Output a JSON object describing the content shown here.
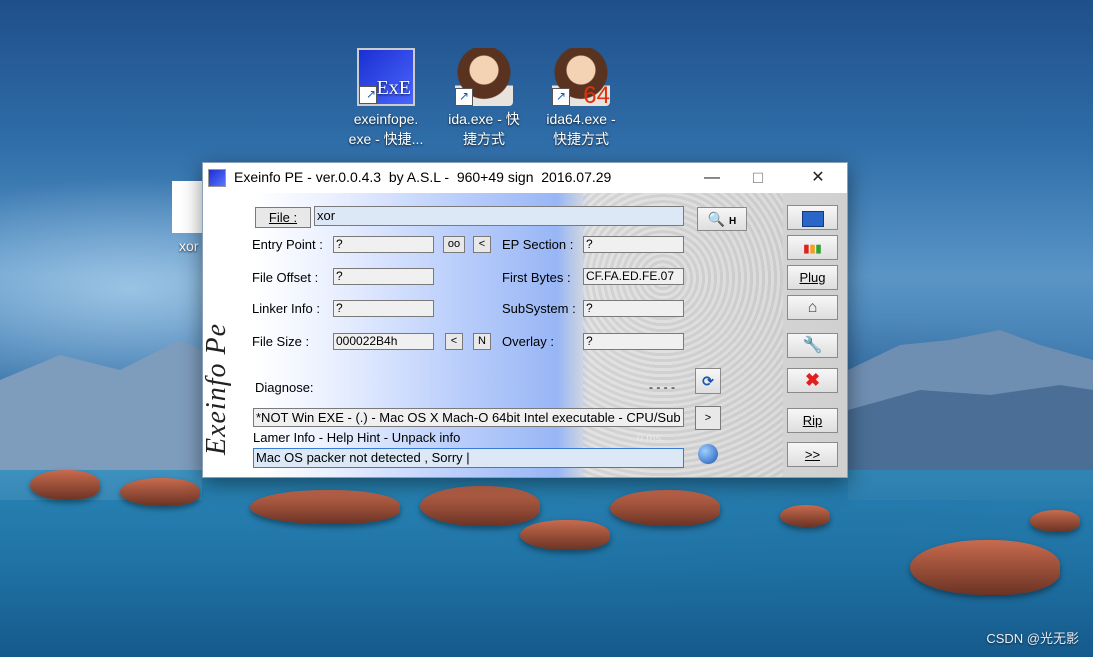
{
  "desktop": {
    "icons": [
      {
        "label_line1": "exeinfope.",
        "label_line2": "exe - 快捷...",
        "img_text": "ExE"
      },
      {
        "label_line1": "ida.exe - 快",
        "label_line2": "捷方式"
      },
      {
        "label_line1": "ida64.exe -",
        "label_line2": "快捷方式",
        "img_text": "64"
      }
    ],
    "partial_label": "xor",
    "watermark": "CSDN @光无影"
  },
  "window": {
    "title": "Exeinfo PE - ver.0.0.4.3  by A.S.L -  960+49 sign  2016.07.29",
    "controls": {
      "minimize": "—",
      "maximize": "☐",
      "close": "✕"
    }
  },
  "exeinfo": {
    "logo_text": "Exeinfo Pe",
    "file_button": "File :",
    "file_value": "xor",
    "search_button_suffix": "H",
    "entry_point": {
      "label": "Entry Point :",
      "value": "?",
      "btn_oo": "oo",
      "btn_lt": "<"
    },
    "ep_section": {
      "label": "EP Section :",
      "value": "?"
    },
    "file_offset": {
      "label": "File Offset :",
      "value": "?"
    },
    "first_bytes": {
      "label": "First Bytes :",
      "value": "CF.FA.ED.FE.07"
    },
    "linker_info": {
      "label": "Linker Info :",
      "value": "?"
    },
    "subsystem": {
      "label": "SubSystem :",
      "value": "?"
    },
    "file_size": {
      "label": "File Size :",
      "value": "000022B4h",
      "btn_lt": "<",
      "btn_n": "N"
    },
    "overlay": {
      "label": "Overlay :",
      "value": "?"
    },
    "diagnose": {
      "label": "Diagnose:",
      "dashes": "- - - -"
    },
    "diagnose_result": "*NOT Win EXE - (.) - Mac OS X Mach-O 64bit Intel executable - CPU/Sub",
    "diagnose_next": ">",
    "lamer_info": "Lamer Info - Help Hint - Unpack info",
    "timing": "0 ms.",
    "packer_result": "Mac OS packer not detected , Sorry |",
    "right_buttons": {
      "plug": "Plug",
      "rip": "Rip",
      "more": ">>"
    }
  },
  "colors": {
    "accent": "#1b2fd0",
    "exit_icon": "#e02020"
  }
}
